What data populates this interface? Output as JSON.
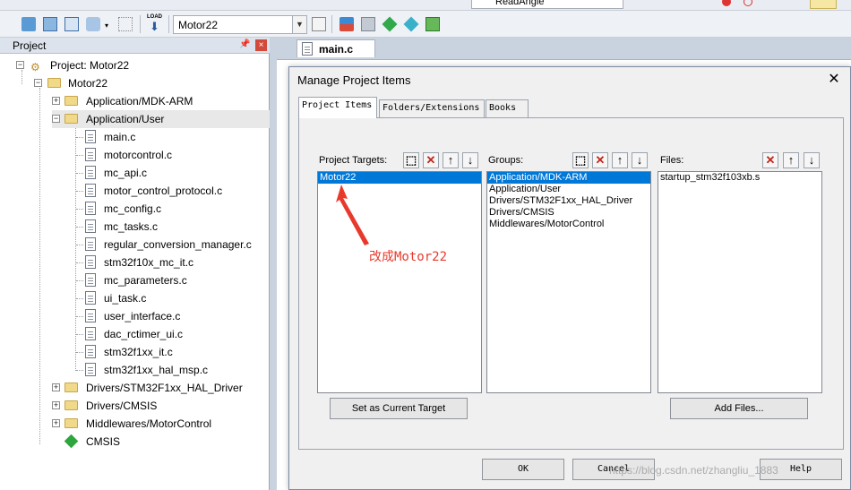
{
  "toolbar_top": {
    "target_combo": "Motor22",
    "find_combo": "ReadAngle",
    "load_label": "LOAD"
  },
  "project_panel": {
    "title": "Project",
    "pin": "\u0004",
    "close": "×",
    "root": "Project: Motor22",
    "target": "Motor22",
    "groups": [
      {
        "label": "Application/MDK-ARM",
        "expanded": false
      },
      {
        "label": "Application/User",
        "expanded": true
      },
      {
        "label": "Drivers/STM32F1xx_HAL_Driver",
        "expanded": false
      },
      {
        "label": "Drivers/CMSIS",
        "expanded": false
      },
      {
        "label": "Middlewares/MotorControl",
        "expanded": false
      }
    ],
    "user_files": [
      "main.c",
      "motorcontrol.c",
      "mc_api.c",
      "motor_control_protocol.c",
      "mc_config.c",
      "mc_tasks.c",
      "regular_conversion_manager.c",
      "stm32f10x_mc_it.c",
      "mc_parameters.c",
      "ui_task.c",
      "user_interface.c",
      "dac_rctimer_ui.c",
      "stm32f1xx_it.c",
      "stm32f1xx_hal_msp.c"
    ],
    "cmsis": "CMSIS"
  },
  "editor": {
    "tab_label": "main.c"
  },
  "dialog": {
    "title": "Manage Project Items",
    "close": "✕",
    "tabs": [
      "Project Items",
      "Folders/Extensions",
      "Books"
    ],
    "targets_label": "Project Targets:",
    "groups_label": "Groups:",
    "files_label": "Files:",
    "targets": [
      "Motor22"
    ],
    "groups": [
      "Application/MDK-ARM",
      "Application/User",
      "Drivers/STM32F1xx_HAL_Driver",
      "Drivers/CMSIS",
      "Middlewares/MotorControl"
    ],
    "files": [
      "startup_stm32f103xb.s"
    ],
    "set_current_button": "Set as Current Target",
    "add_files_button": "Add Files...",
    "ok_button": "OK",
    "cancel_button": "Cancel",
    "help_button": "Help"
  },
  "annotation": {
    "text": "改成Motor22",
    "color": "#e83a2c"
  },
  "watermark": "https://blog.csdn.net/zhangliu_1883",
  "colors": {
    "selection": "#0078d7",
    "annotation_red": "#e83a2c"
  }
}
